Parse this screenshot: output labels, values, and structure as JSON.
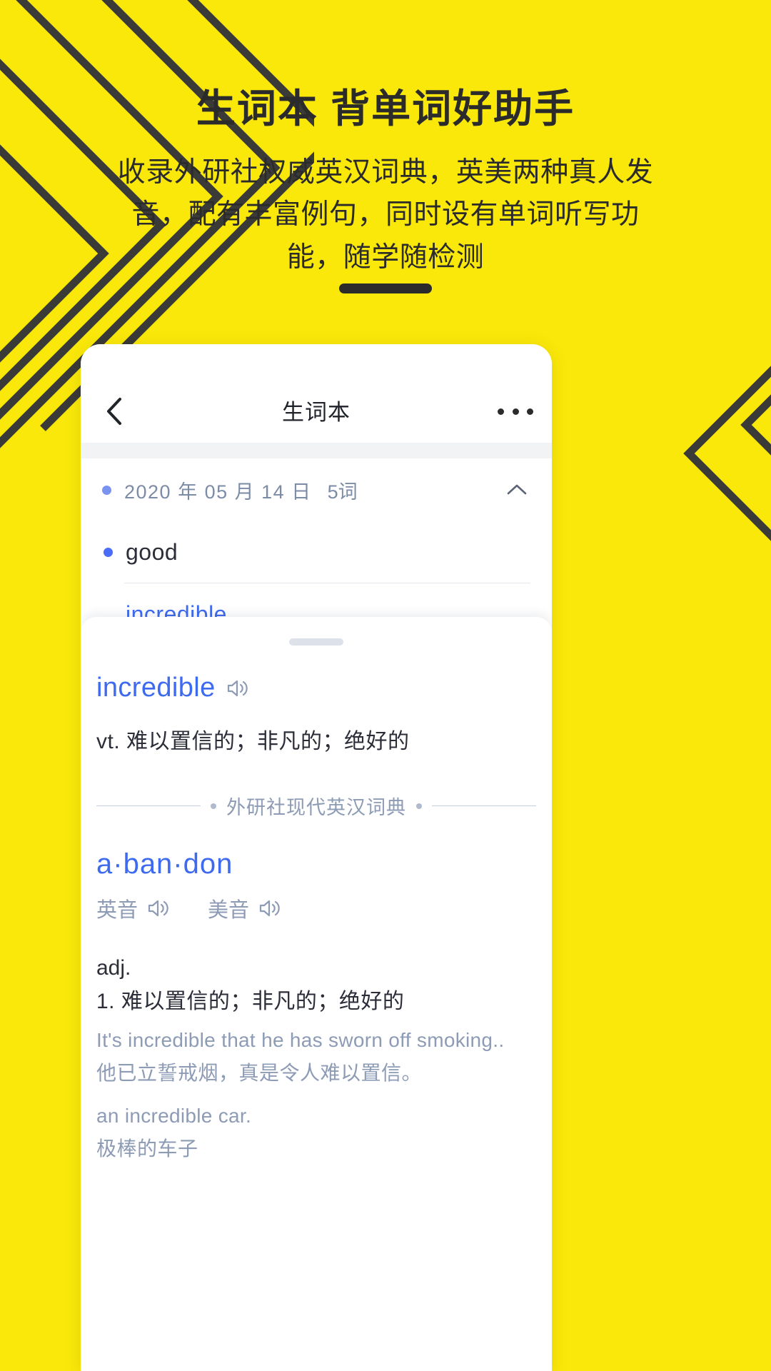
{
  "poster": {
    "background_color": "#FAE80A",
    "ink_color": "#2B2B2B",
    "headline": "生词本  背单词好助手",
    "subheadline": "收录外研社权威英汉词典，英美两种真人发音，配有丰富例句，同时设有单词听写功能，随学随检测"
  },
  "phone": {
    "navbar": {
      "back_icon": "chevron-left-icon",
      "title": "生词本",
      "more_icon": "more-horizontal-icon"
    },
    "wordlist": {
      "group": {
        "date": "2020 年 05 月 14 日",
        "count": "5词",
        "collapse_icon": "chevron-up-icon"
      },
      "words": [
        {
          "text": "good",
          "selected": false
        },
        {
          "text": "incredible",
          "selected": true
        }
      ]
    },
    "sheet": {
      "handle": "drag-handle",
      "entry": {
        "word": "incredible",
        "speaker_icon": "speaker-icon",
        "definition": "vt. 难以置信的；非凡的；绝好的"
      },
      "source_label": "外研社现代英汉词典",
      "detail": {
        "headword": "a·ban·don",
        "pronunciations": [
          {
            "label": "英音",
            "icon": "speaker-icon"
          },
          {
            "label": "美音",
            "icon": "speaker-icon"
          }
        ],
        "part_of_speech": "adj.",
        "sense": "1. 难以置信的；非凡的；绝好的",
        "examples": [
          {
            "en": "It's incredible that he has sworn off smoking..",
            "zh": "他已立誓戒烟，真是令人难以置信。"
          },
          {
            "en": "an incredible car.",
            "zh": "极棒的车子"
          }
        ]
      }
    }
  },
  "colors": {
    "brand_yellow": "#FAE80A",
    "ink": "#2B2B2B",
    "link_blue": "#3E6AF0",
    "muted_blue_gray": "#8D9BB5"
  }
}
